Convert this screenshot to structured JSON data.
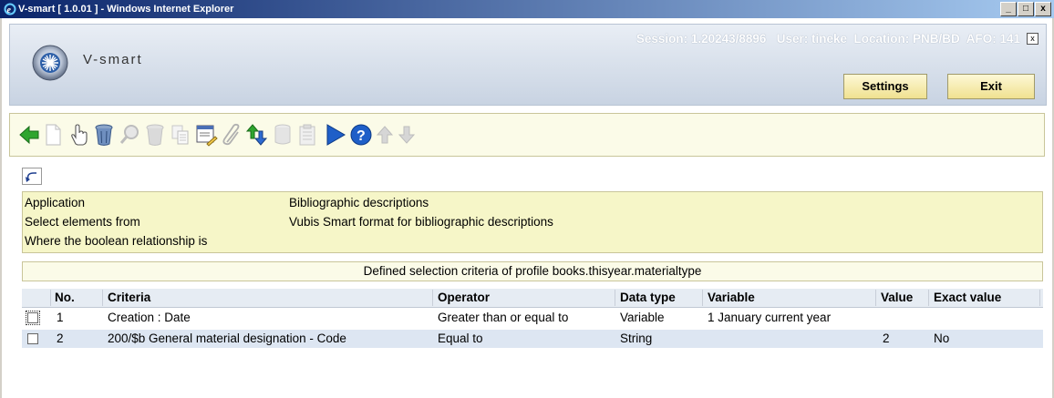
{
  "window": {
    "title": "V-smart [ 1.0.01 ] - Windows Internet Explorer",
    "minimize": "_",
    "maximize": "□",
    "close": "x"
  },
  "header": {
    "brand": "V-smart",
    "session_info": "Session: 1.20243/8896   User: tineke  Location: PNB/BD  AFO: 141",
    "close_label": "x",
    "settings_label": "Settings",
    "exit_label": "Exit"
  },
  "toolbar": {
    "icons": [
      "back-arrow-icon",
      "new-document-icon",
      "hand-select-icon",
      "delete-trash-icon",
      "search-magnifier-icon",
      "trash-disabled-icon",
      "copy-icon",
      "edit-form-icon",
      "attach-clip-icon",
      "sort-arrows-icon",
      "database-icon",
      "clipboard-icon",
      "run-play-icon",
      "help-icon",
      "up-arrow-icon",
      "down-arrow-icon"
    ]
  },
  "info": {
    "rows": [
      {
        "label": "Application",
        "value": "Bibliographic descriptions"
      },
      {
        "label": "Select elements from",
        "value": "Vubis Smart format for bibliographic descriptions"
      },
      {
        "label": "Where the boolean relationship is",
        "value": ""
      }
    ]
  },
  "criteria_title": "Defined selection criteria of profile books.thisyear.materialtype",
  "table": {
    "columns": [
      "No.",
      "Criteria",
      "Operator",
      "Data type",
      "Variable",
      "Value",
      "Exact value"
    ],
    "rows": [
      {
        "no": "1",
        "criteria": "Creation : Date",
        "operator": "Greater than or equal to",
        "data_type": "Variable",
        "variable": "1 January current year",
        "value": "",
        "exact": ""
      },
      {
        "no": "2",
        "criteria": "200/$b General material designation - Code",
        "operator": "Equal to",
        "data_type": "String",
        "variable": "",
        "value": "2",
        "exact": "No"
      }
    ]
  },
  "colors": {
    "header_button": "#f0e190",
    "info_background": "#f6f6c8",
    "selected_row": "#dde6f2",
    "play_icon": "#1f5fc8",
    "green_arrow": "#2fa52f"
  }
}
